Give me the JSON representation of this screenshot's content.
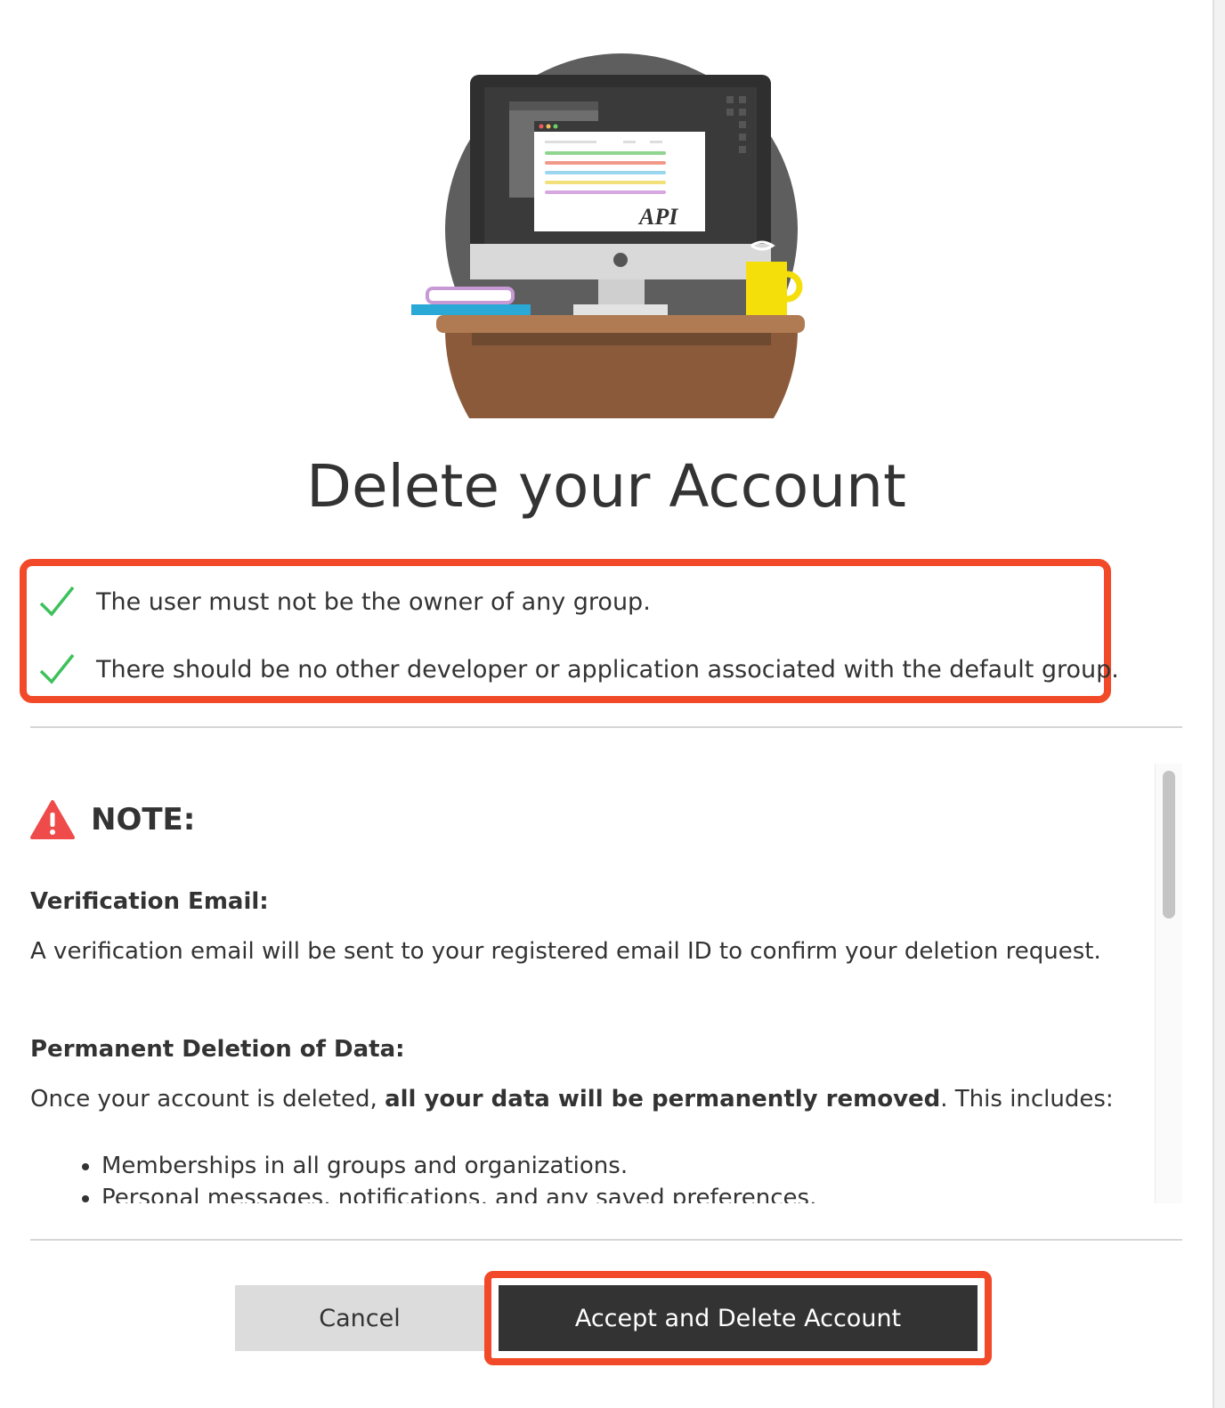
{
  "dialog": {
    "title": "Delete your Account",
    "hero_image": {
      "icon": "api-desk-illustration-icon",
      "screen_label": "API"
    },
    "requirements": [
      {
        "icon": "check-icon",
        "text": "The user must not be the owner of any group."
      },
      {
        "icon": "check-icon",
        "text": "There should be no other developer or application associated with the default group."
      }
    ],
    "note": {
      "icon": "warning-icon",
      "label": "NOTE:",
      "sections": [
        {
          "title": "Verification Email:",
          "text": "A verification email will be sent to your registered email ID to confirm your deletion request."
        },
        {
          "title": "Permanent Deletion of Data:",
          "text_before": "Once your account is deleted, ",
          "text_bold": "all your data will be permanently removed",
          "text_after": ". This includes:",
          "bullets": [
            "Memberships in all groups and organizations.",
            "Personal messages, notifications, and any saved preferences."
          ]
        }
      ]
    },
    "buttons": {
      "cancel_label": "Cancel",
      "accept_label": "Accept and Delete Account"
    },
    "colors": {
      "highlight": "#f24a28",
      "check": "#3cc15b",
      "warning": "#ef4b4b",
      "primary_button": "#333333",
      "secondary_button": "#dcdcdc"
    }
  }
}
